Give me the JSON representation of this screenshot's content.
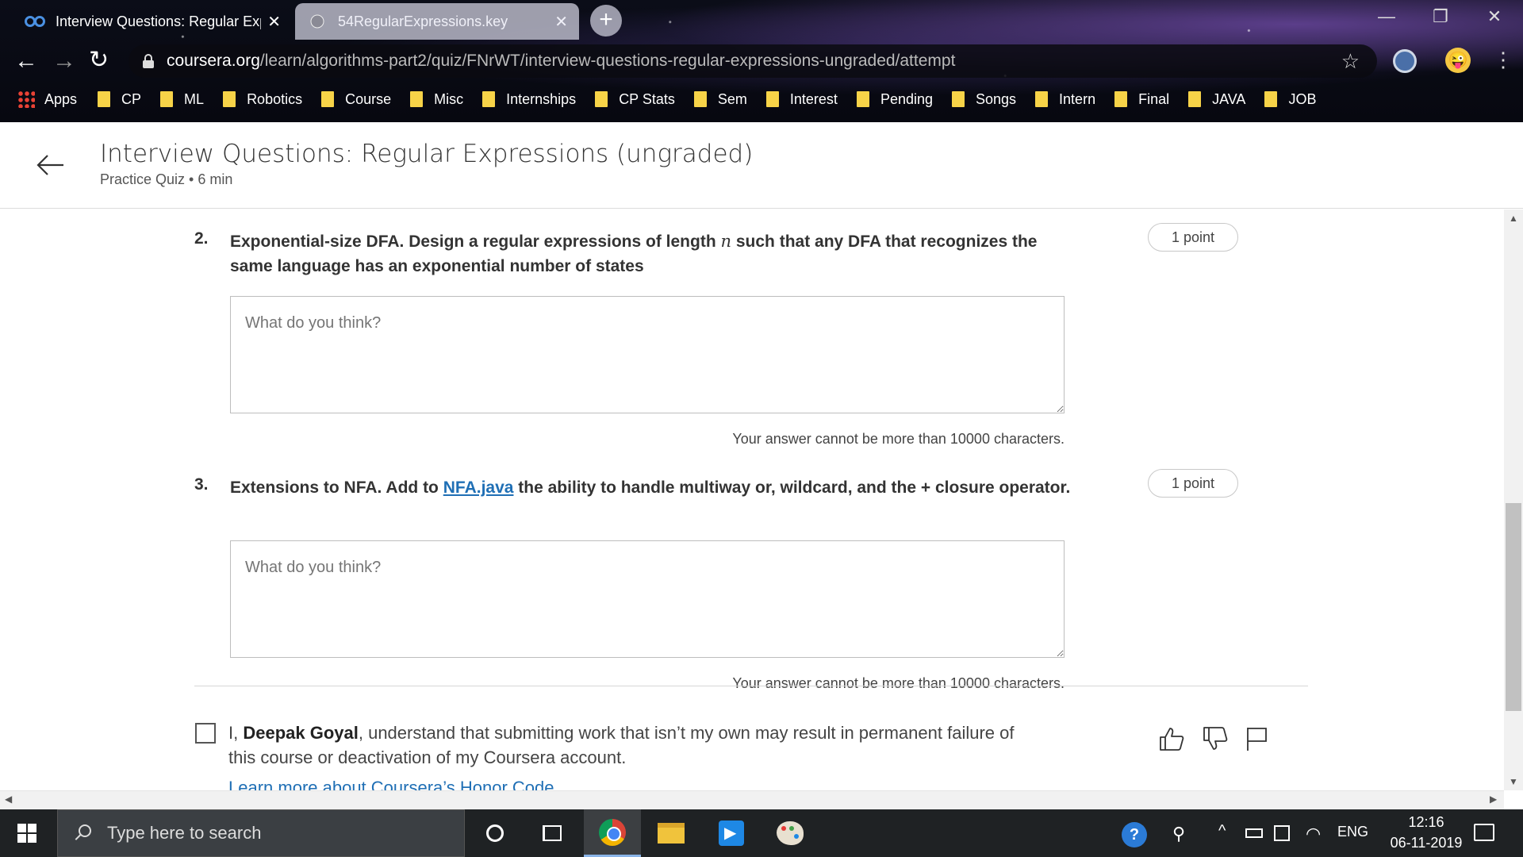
{
  "browser": {
    "tabs": [
      {
        "title": "Interview Questions: Regular Exp",
        "favicon": "coursera-icon",
        "active": true
      },
      {
        "title": "54RegularExpressions.key",
        "favicon": "globe-icon",
        "active": false
      }
    ],
    "url_host": "coursera.org",
    "url_path": "/learn/algorithms-part2/quiz/FNrWT/interview-questions-regular-expressions-ungraded/attempt",
    "bookmarks": [
      "Apps",
      "CP",
      "ML",
      "Robotics",
      "Course",
      "Misc",
      "Internships",
      "CP Stats",
      "Sem",
      "Interest",
      "Pending",
      "Songs",
      "Intern",
      "Final",
      "JAVA",
      "JOB"
    ]
  },
  "header": {
    "title": "Interview Questions: Regular Expressions (ungraded)",
    "subtitle": "Practice Quiz • 6 min"
  },
  "questions": [
    {
      "number": "2.",
      "text_before": "Exponential-size DFA. Design a regular expressions of length ",
      "math": "n",
      "text_after": " such that any DFA that recognizes the same language has an exponential number of states",
      "points": "1 point",
      "placeholder": "What do you think?",
      "limit_note": "Your answer cannot be more than 10000 characters."
    },
    {
      "number": "3.",
      "text_before": "Extensions to NFA. Add to ",
      "link": "NFA.java",
      "text_after": " the ability to handle multiway or, wildcard, and the + closure operator.",
      "points": "1 point",
      "placeholder": "What do you think?",
      "limit_note": "Your answer cannot be more than 10000 characters."
    }
  ],
  "honor": {
    "prefix": "I, ",
    "name": "Deepak Goyal",
    "suffix": ", understand that submitting work that isn’t my own may result in permanent failure of this course or deactivation of my Coursera account.",
    "link": "Learn more about Coursera’s Honor Code"
  },
  "taskbar": {
    "search_placeholder": "Type here to search",
    "language": "ENG",
    "time": "12:16",
    "date": "06-11-2019"
  },
  "colors": {
    "link": "#1f6fb5",
    "folder": "#f7d348",
    "taskbar": "#1f2224"
  }
}
